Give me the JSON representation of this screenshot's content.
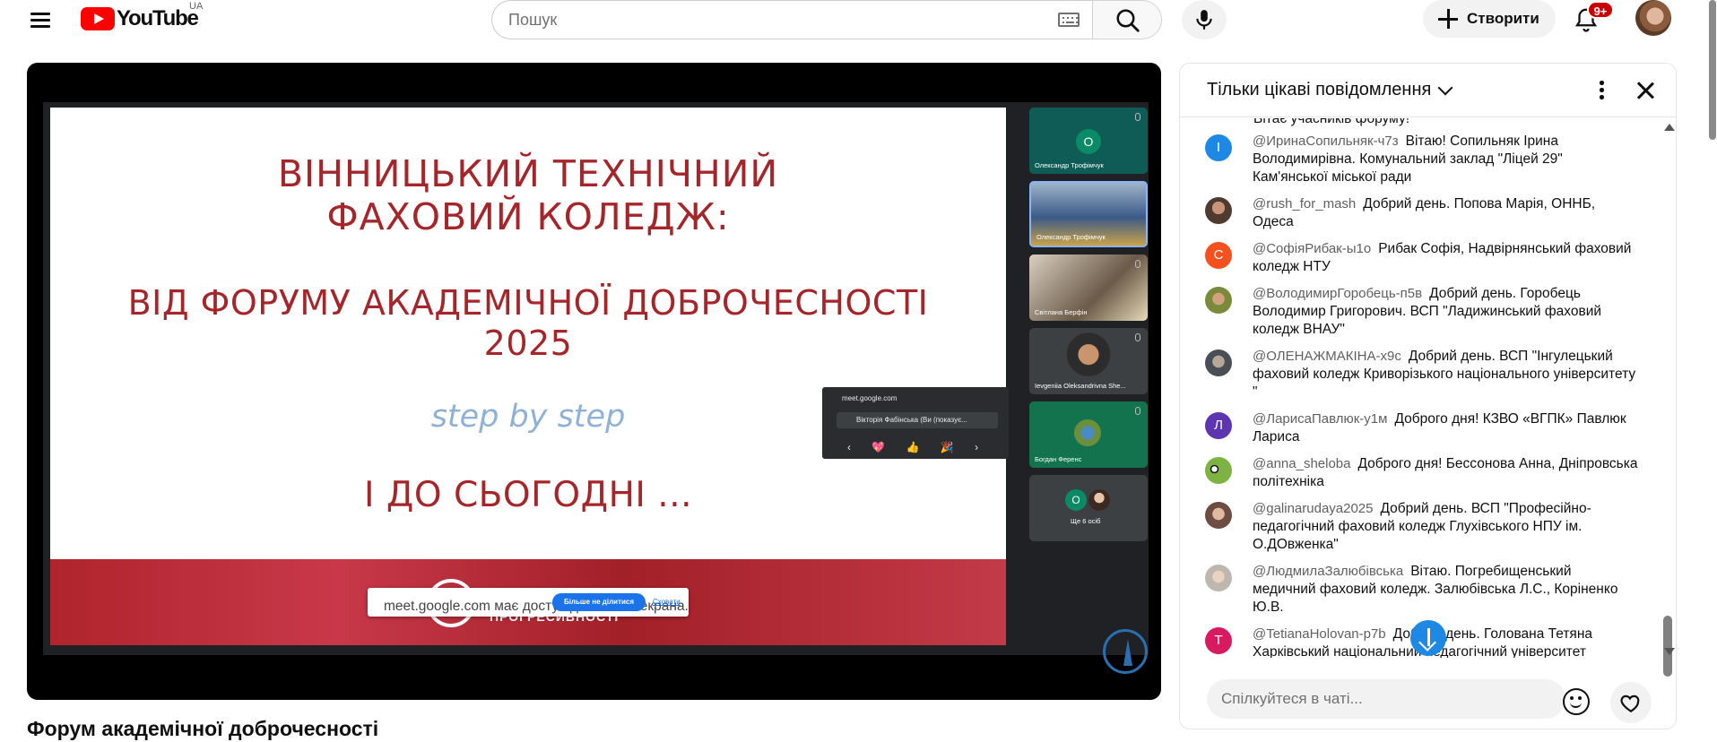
{
  "header": {
    "logo_text": "YouTube",
    "region": "UA",
    "search_placeholder": "Пошук",
    "create_label": "Створити",
    "notifications_badge": "9+"
  },
  "player": {
    "slide": {
      "title_line1": "ВІННИЦЬКИЙ ТЕХНІЧНИЙ",
      "title_line2": "ФАХОВИЙ КОЛЕДЖ:",
      "subtitle_line1": "ВІД ФОРУМУ АКАДЕМІЧНОЇ ДОБРОЧЕСНОСТІ",
      "subtitle_line2": "2025",
      "tagline": "step by step",
      "closing": "І ДО СЬОГОДНІ ...",
      "band_text": "ПРОГРЕСИВНОСТІ"
    },
    "share_bar": {
      "message": "meet.google.com має доступ до вашого екрана.",
      "stop_label": "Більше не ділитися",
      "hide_label": "Сховати"
    },
    "popup": {
      "url": "meet.google.com",
      "presenter": "Вікторія Фабінська (Ви (показує...",
      "reactions": "‹ 💖 👍 🎉 ›"
    },
    "participants": [
      {
        "name": "Олександр Трофімчук",
        "initial": "О"
      },
      {
        "name": "Олександр Трофімчук"
      },
      {
        "name": "Світлана Берфін"
      },
      {
        "name": "Ievgeniia Oleksandrivna She..."
      },
      {
        "name": "Богдан Ференс"
      },
      {
        "name": "Ще 6 осіб",
        "initial": "О"
      }
    ]
  },
  "video_title": "Форум академічної доброчесності",
  "chat": {
    "mode_label": "Тільки цікаві повідомлення",
    "cut_text": "Вітає учасників форуму!",
    "messages": [
      {
        "author": "@ИринаСопильняк-ч7з",
        "text": "Вітаю! Сопильняк Ірина Володимирівна. Комунальний заклад \"Ліцей 29\" Кам'янської міської ради",
        "initial": "І",
        "color": "#1e88e5"
      },
      {
        "author": "@rush_for_mash",
        "text": "Добрий день. Попова Марія, ОННБ, Одеса",
        "initial": "",
        "color": "#4e3a2e"
      },
      {
        "author": "@СофіяРибак-ы1о",
        "text": "Рибак Софія, Надвірнянський фаховий коледж НТУ",
        "initial": "С",
        "color": "#f4511e"
      },
      {
        "author": "@ВолодимирГоробець-п5в",
        "text": "Добрий день. Горобець Володимир Григорович. ВСП \"Ладижинський фаховий коледж ВНАУ\"",
        "initial": "",
        "color": "#7a6a3a"
      },
      {
        "author": "@ОЛЕНАЖМАКІНА-х9с",
        "text": "Добрий день. ВСП \"Інгулецький фаховий коледж Криворізького національного університету \"",
        "initial": "",
        "color": "#5b6068"
      },
      {
        "author": "@ЛарисаПавлюк-у1м",
        "text": "Доброго дня! КЗВО «ВГПК» Павлюк Лариса",
        "initial": "Л",
        "color": "#5e35b1"
      },
      {
        "author": "@anna_sheloba",
        "text": "Доброго дня! Бессонова Анна, Дніпровська політехніка",
        "initial": "",
        "color": "#7cb342"
      },
      {
        "author": "@galinarudaya2025",
        "text": "Добрий день. ВСП \"Професійно-педагогічний фаховий коледж Глухівського НПУ ім. О.ДОвженка\"",
        "initial": "",
        "color": "#8d6e63"
      },
      {
        "author": "@ЛюдмилаЗалюбівська",
        "text": "Вітаю. Погребищенський медичний фаховий коледж. Залюбівська Л.С., Коріненко Ю.В.",
        "initial": "",
        "color": "#bdb7ae"
      },
      {
        "author": "@TetianaHolovan-p7b",
        "text": "Добрий день. Голована Тетяна Харківський національний педагогічний університет",
        "initial": "T",
        "color": "#d81b60"
      }
    ],
    "input_placeholder": "Спілкуйтеся в чаті..."
  }
}
